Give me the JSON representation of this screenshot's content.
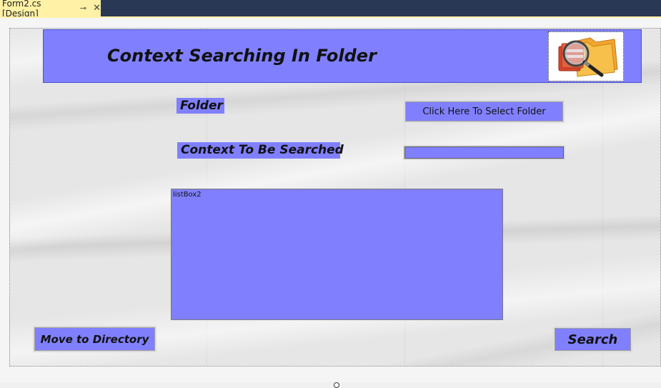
{
  "tab": {
    "title": "Form2.cs [Design]",
    "pin_icon": "pin-icon",
    "close_icon": "close-icon"
  },
  "form": {
    "header_title": "Context Searching In Folder",
    "logo_icon": "folder-magnifier-icon",
    "folder_label": "Folder",
    "context_label": "Context To Be Searched",
    "select_folder_button": "Click Here To Select Folder",
    "context_input_value": "",
    "listbox_name": "listBox2",
    "move_button": "Move to Directory",
    "search_button": "Search"
  },
  "colors": {
    "form_control": "#8080ff",
    "tab_active": "#fff1a5",
    "tabstrip": "#293955"
  }
}
